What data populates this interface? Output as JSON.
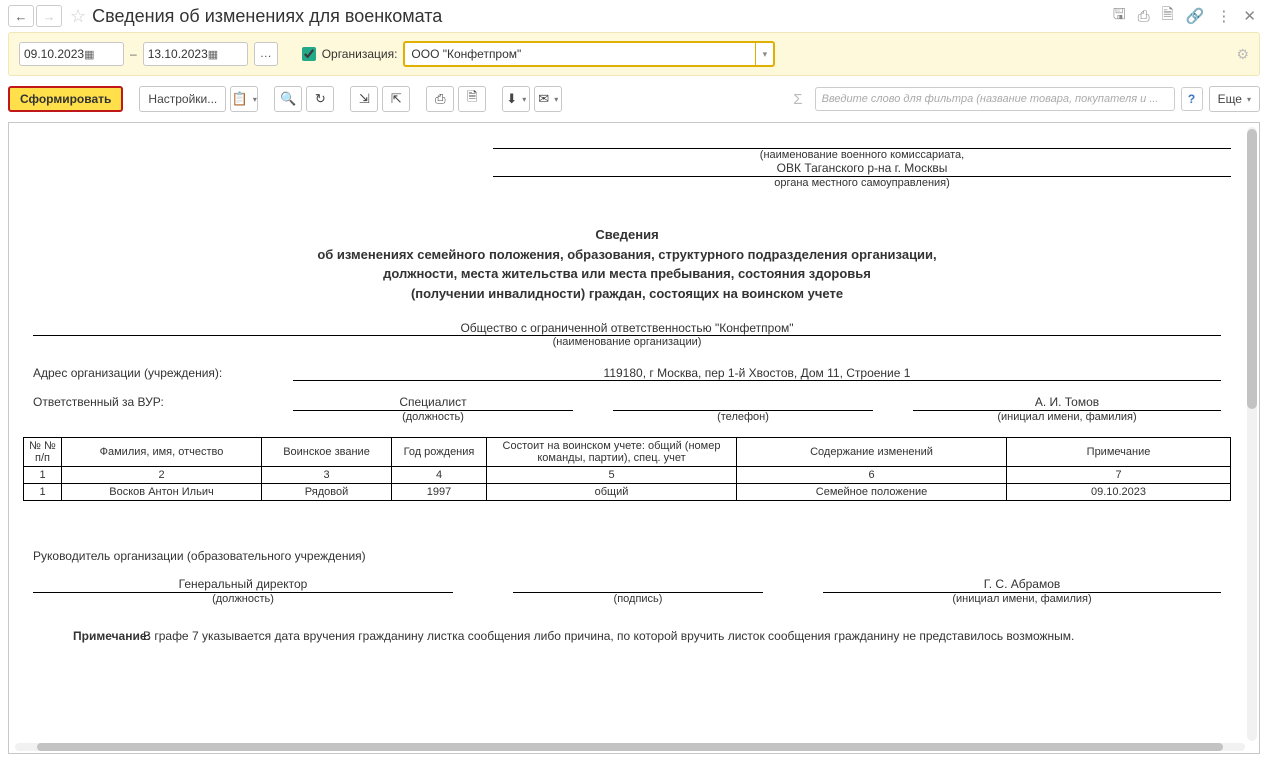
{
  "titlebar": {
    "title": "Сведения об изменениях для военкомата"
  },
  "filter": {
    "date_from": "09.10.2023",
    "date_to": "13.10.2023",
    "org_label": "Организация:",
    "org_value": "ООО \"Конфетпром\""
  },
  "toolbar": {
    "generate": "Сформировать",
    "settings": "Настройки...",
    "more": "Еще",
    "search_placeholder": "Введите слово для фильтра (название товара, покупателя и ..."
  },
  "report": {
    "head_sub1": "(наименование военного комиссариата,",
    "head_line2": "ОВК Таганского р-на г. Москвы",
    "head_sub2": "органа местного самоуправления)",
    "title1": "Сведения",
    "title2": "об изменениях семейного положения, образования, структурного подразделения организации,",
    "title3": "должности, места жительства или места пребывания, состояния здоровья",
    "title4": "(получении инвалидности) граждан, состоящих на воинском учете",
    "org_name": "Общество с ограниченной ответственностью \"Конфетпром\"",
    "org_sub": "(наименование организации)",
    "addr_label": "Адрес организации (учреждения):",
    "addr_value": "119180, г Москва, пер 1-й Хвостов, Дом 11, Строение 1",
    "resp_label": "Ответственный за ВУР:",
    "resp_pos": "Специалист",
    "resp_pos_sub": "(должность)",
    "resp_tel": "",
    "resp_tel_sub": "(телефон)",
    "resp_name": "А. И. Томов",
    "resp_name_sub": "(инициал имени, фамилия)",
    "headers": {
      "c1": "№ № п/п",
      "c2": "Фамилия, имя, отчество",
      "c3": "Воинское звание",
      "c4": "Год рождения",
      "c5": "Состоит на воинском учете: общий (номер команды, партии), спец. учет",
      "c6": "Содержание изменений",
      "c7": "Примечание"
    },
    "numrow": {
      "c1": "1",
      "c2": "2",
      "c3": "3",
      "c4": "4",
      "c5": "5",
      "c6": "6",
      "c7": "7"
    },
    "rows": [
      {
        "c1": "1",
        "c2": "Восков Антон Ильич",
        "c3": "Рядовой",
        "c4": "1997",
        "c5": "общий",
        "c6": "Семейное положение",
        "c7": "09.10.2023"
      }
    ],
    "sign_title": "Руководитель организации (образовательного учреждения)",
    "sign_pos": "Генеральный директор",
    "sign_pos_sub": "(должность)",
    "sign_sig_sub": "(подпись)",
    "sign_name": "Г. С. Абрамов",
    "sign_name_sub": "(инициал имени, фамилия)",
    "note_label": "Примечание:",
    "note_text": "В графе 7 указывается дата вручения гражданину листка сообщения либо причина, по которой вручить листок сообщения гражданину не представилось возможным."
  }
}
